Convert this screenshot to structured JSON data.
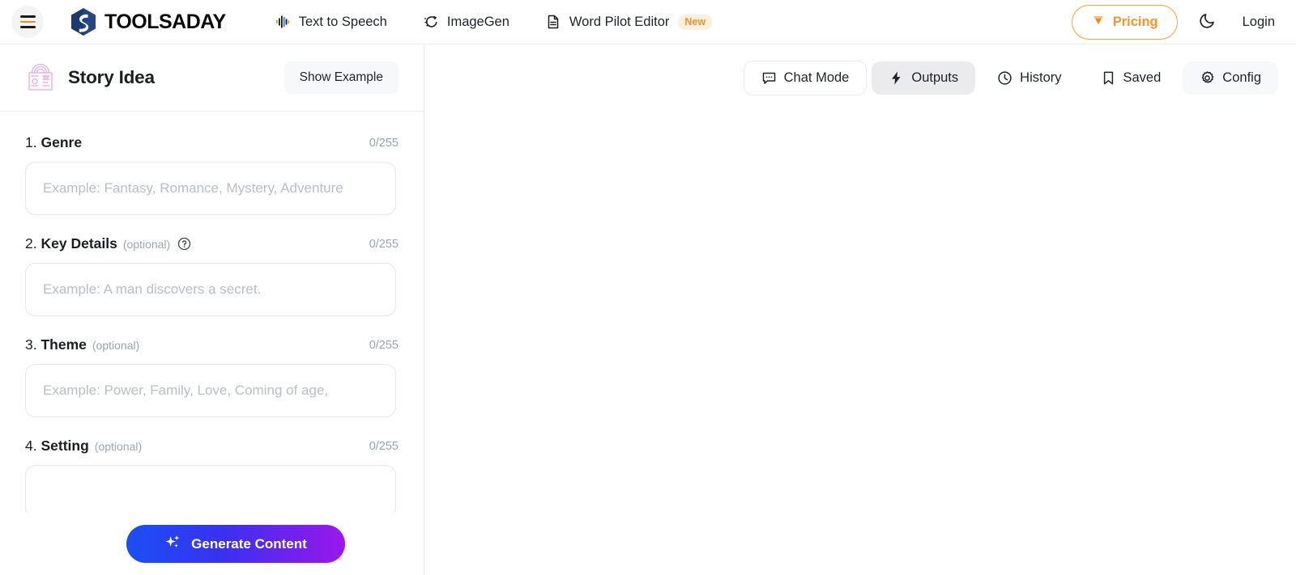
{
  "header": {
    "menu_icon": "hamburger-icon",
    "brand": "TOOLSADAY",
    "nav_items": [
      {
        "label": "Text to Speech",
        "icon": "audio-waveform-icon"
      },
      {
        "label": "ImageGen",
        "icon": "image-sparkle-icon"
      },
      {
        "label": "Word Pilot Editor",
        "icon": "document-icon",
        "badge": "New"
      }
    ],
    "pricing_label": "Pricing",
    "pricing_icon": "diamond-icon",
    "theme_toggle_icon": "moon-icon",
    "login_label": "Login",
    "accent_orange": "#f7952a"
  },
  "tool": {
    "title": "Story Idea",
    "icon": "open-book-icon",
    "show_example_label": "Show Example",
    "fields": [
      {
        "number": "1.",
        "label": "Genre",
        "optional": "",
        "has_help": false,
        "counter": "0/255",
        "value": "",
        "placeholder": "Example: Fantasy, Romance, Mystery, Adventure"
      },
      {
        "number": "2.",
        "label": "Key Details",
        "optional": "(optional)",
        "has_help": true,
        "counter": "0/255",
        "value": "",
        "placeholder": "Example: A man discovers a secret."
      },
      {
        "number": "3.",
        "label": "Theme",
        "optional": "(optional)",
        "has_help": false,
        "counter": "0/255",
        "value": "",
        "placeholder": "Example: Power, Family, Love, Coming of age,"
      },
      {
        "number": "4.",
        "label": "Setting",
        "optional": "(optional)",
        "has_help": false,
        "counter": "0/255",
        "value": "",
        "placeholder": ""
      }
    ],
    "generate_label": "Generate Content",
    "generate_icon": "sparkles-icon",
    "generate_gradient_from": "#1a4ff5",
    "generate_gradient_to": "#9b17ec"
  },
  "right_panel": {
    "tabs": [
      {
        "label": "Chat Mode",
        "icon": "chat-bubble-icon",
        "state": "outlined"
      },
      {
        "label": "Outputs",
        "icon": "lightning-icon",
        "state": "active"
      },
      {
        "label": "History",
        "icon": "clock-icon",
        "state": "plain"
      },
      {
        "label": "Saved",
        "icon": "bookmark-icon",
        "state": "plain"
      },
      {
        "label": "Config",
        "icon": "gear-icon",
        "state": "subtle"
      }
    ]
  }
}
